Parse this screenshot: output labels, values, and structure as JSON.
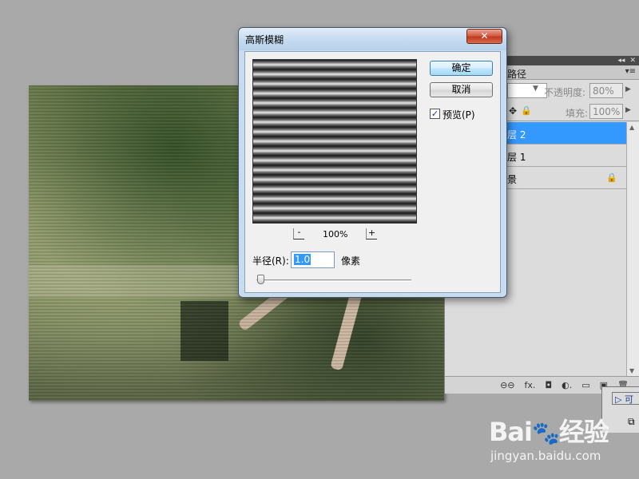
{
  "dialog": {
    "title": "高斯模糊",
    "close_label": "✕",
    "ok_label": "确定",
    "cancel_label": "取消",
    "preview_label": "预览(P)",
    "preview_checked": "✓",
    "zoom_out_label": "-",
    "zoom_level": "100%",
    "zoom_in_label": "+",
    "radius_label": "半径(R):",
    "radius_value": "1.0",
    "radius_unit": "像素",
    "radius_slider_fraction": 0.03
  },
  "layers_panel": {
    "collapse_icon": "◂◂",
    "close_icon": "✕",
    "tab_paths": "路径",
    "menu_icon": "▾≡",
    "opacity_label": "不透明度:",
    "opacity_value": "80%",
    "fill_label": "填充:",
    "fill_value": "100%",
    "lock_move_icon": "✥",
    "lock_all_icon": "🔒",
    "layers": [
      {
        "name": "层 2",
        "selected": true
      },
      {
        "name": "层 1",
        "selected": false
      },
      {
        "name": "景",
        "selected": false,
        "locked": true
      }
    ],
    "footer_icons": [
      "link-icon",
      "fx-icon",
      "mask-icon",
      "adjustment-icon",
      "group-icon",
      "new-layer-icon",
      "trash-icon"
    ],
    "footer_labels": [
      "⊖⊖",
      "fx.",
      "◘",
      "◐.",
      "▭",
      "▣",
      "🗑"
    ]
  },
  "history_fragment": {
    "item_label": "▷ 可",
    "icon_label": "⧉"
  },
  "watermark": {
    "brand": "Bai",
    "brand_paw": "🐾",
    "brand_suffix": "经验",
    "url": "jingyan.baidu.com"
  },
  "colors": {
    "selection": "#3399ff",
    "dialog_frame": "#c8dcf0",
    "close_button": "#c23b22"
  }
}
